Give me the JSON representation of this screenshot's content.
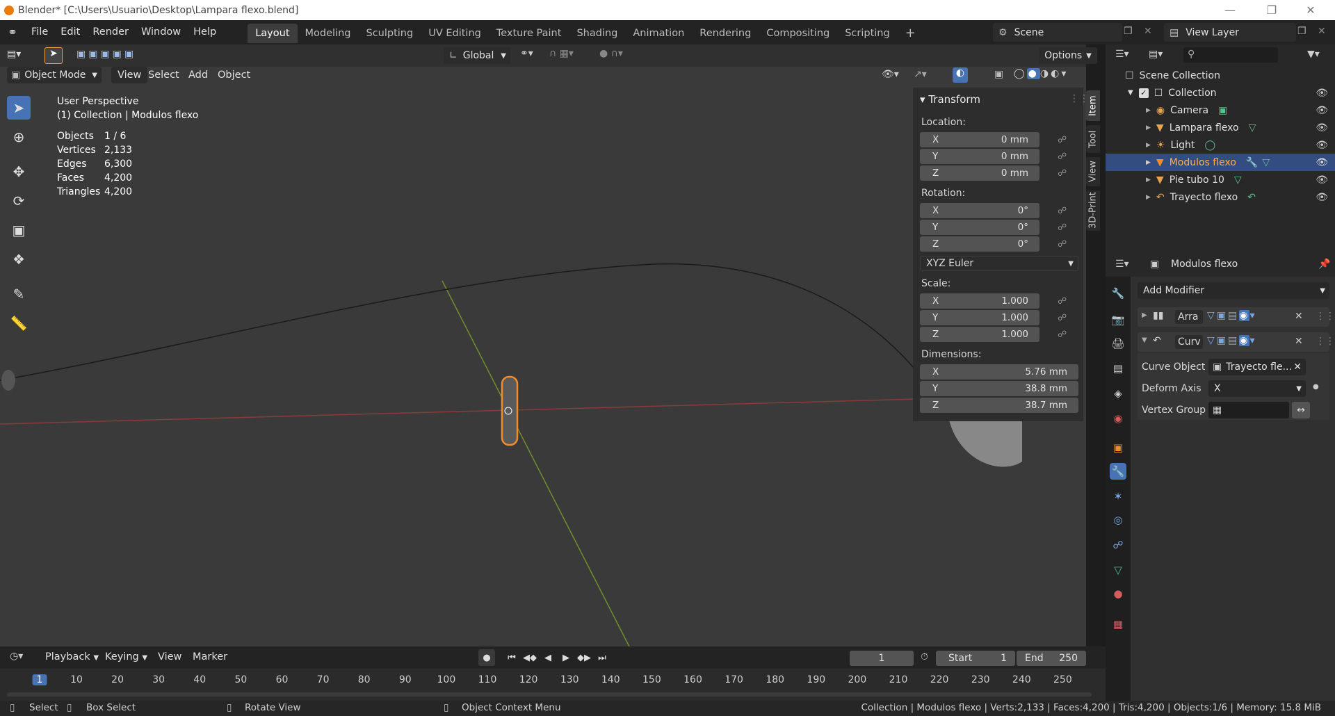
{
  "window": {
    "title": "Blender* [C:\\Users\\Usuario\\Desktop\\Lampara flexo.blend]"
  },
  "menus": [
    "File",
    "Edit",
    "Render",
    "Window",
    "Help"
  ],
  "workspaces": [
    "Layout",
    "Modeling",
    "Sculpting",
    "UV Editing",
    "Texture Paint",
    "Shading",
    "Animation",
    "Rendering",
    "Compositing",
    "Scripting"
  ],
  "active_workspace": "Layout",
  "scene": "Scene",
  "view_layer": "View Layer",
  "viewport_header": {
    "transform_orientation": "Global",
    "options": "Options",
    "mode": "Object Mode",
    "menus": [
      "View",
      "Select",
      "Add",
      "Object"
    ]
  },
  "overlay_info": {
    "perspective": "User Perspective",
    "collection": "(1) Collection | Modulos flexo",
    "stats": [
      {
        "label": "Objects",
        "value": "1 / 6"
      },
      {
        "label": "Vertices",
        "value": "2,133"
      },
      {
        "label": "Edges",
        "value": "6,300"
      },
      {
        "label": "Faces",
        "value": "4,200"
      },
      {
        "label": "Triangles",
        "value": "4,200"
      }
    ]
  },
  "n_panel": {
    "title": "Transform",
    "location_label": "Location:",
    "location": [
      {
        "axis": "X",
        "value": "0 mm"
      },
      {
        "axis": "Y",
        "value": "0 mm"
      },
      {
        "axis": "Z",
        "value": "0 mm"
      }
    ],
    "rotation_label": "Rotation:",
    "rotation": [
      {
        "axis": "X",
        "value": "0°"
      },
      {
        "axis": "Y",
        "value": "0°"
      },
      {
        "axis": "Z",
        "value": "0°"
      }
    ],
    "rotation_mode": "XYZ Euler",
    "scale_label": "Scale:",
    "scale": [
      {
        "axis": "X",
        "value": "1.000"
      },
      {
        "axis": "Y",
        "value": "1.000"
      },
      {
        "axis": "Z",
        "value": "1.000"
      }
    ],
    "dimensions_label": "Dimensions:",
    "dimensions": [
      {
        "axis": "X",
        "value": "5.76 mm"
      },
      {
        "axis": "Y",
        "value": "38.8 mm"
      },
      {
        "axis": "Z",
        "value": "38.7 mm"
      }
    ],
    "tabs": [
      "Item",
      "Tool",
      "View",
      "3D-Print"
    ]
  },
  "outliner": {
    "root": "Scene Collection",
    "collection": "Collection",
    "items": [
      "Camera",
      "Lampara flexo",
      "Light",
      "Modulos flexo",
      "Pie tubo 10",
      "Trayecto flexo"
    ],
    "selected": "Modulos flexo"
  },
  "properties": {
    "object_name": "Modulos flexo",
    "add_modifier": "Add Modifier",
    "modifiers": [
      {
        "name": "Arra",
        "expanded": false
      },
      {
        "name": "Curv",
        "expanded": true
      }
    ],
    "curve_object_label": "Curve Object",
    "curve_object_value": "Trayecto fle...",
    "deform_axis_label": "Deform Axis",
    "deform_axis_value": "X",
    "vertex_group_label": "Vertex Group"
  },
  "timeline": {
    "menus": [
      "Playback",
      "Keying",
      "View",
      "Marker"
    ],
    "current_frame": "1",
    "start_label": "Start",
    "start": "1",
    "end_label": "End",
    "end": "250",
    "ticks": [
      "1",
      "10",
      "20",
      "30",
      "40",
      "50",
      "60",
      "70",
      "80",
      "90",
      "100",
      "110",
      "120",
      "130",
      "140",
      "150",
      "160",
      "170",
      "180",
      "190",
      "200",
      "210",
      "220",
      "230",
      "240",
      "250"
    ]
  },
  "statusbar": {
    "select": "Select",
    "box_select": "Box Select",
    "rotate_view": "Rotate View",
    "context_menu": "Object Context Menu",
    "info": "Collection | Modulos flexo | Verts:2,133 | Faces:4,200 | Tris:4,200 | Objects:1/6 | Memory: 15.8 MiB"
  },
  "colors": {
    "accent": "#4772b3",
    "selection": "#f28c28",
    "x_axis": "#8b3a3a",
    "y_axis": "#6f8f2b"
  }
}
